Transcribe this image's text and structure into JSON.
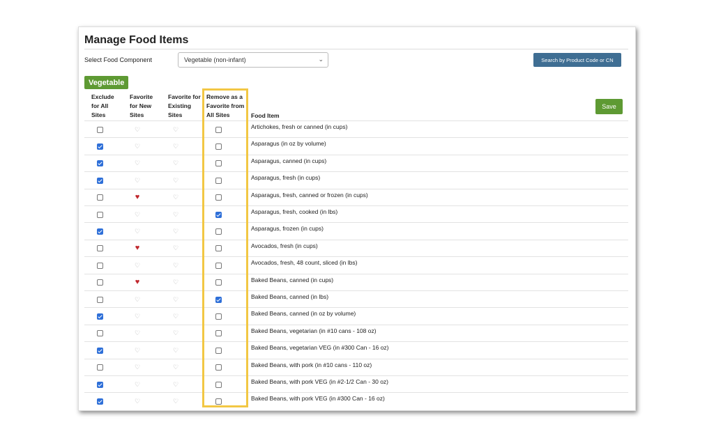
{
  "page": {
    "title": "Manage Food Items",
    "select_label": "Select Food Component",
    "selected_component": "Vegetable (non-infant)",
    "search_button": "Search by Product Code or CN",
    "category": "Vegetable",
    "save_button": "Save"
  },
  "columns": {
    "exclude": "Exclude for All Sites",
    "fav_new": "Favorite for New Sites",
    "fav_existing": "Favorite for Existing Sites",
    "remove_fav": "Remove as a Favorite from All Sites",
    "food_item": "Food Item"
  },
  "colors": {
    "accent_green": "#5e9a33",
    "search_blue": "#3f6e93",
    "highlight": "#f2c744",
    "heart_red": "#c0272d"
  },
  "rows": [
    {
      "exclude": false,
      "fav_new": false,
      "remove": false,
      "item": "Artichokes, fresh or canned (in cups)"
    },
    {
      "exclude": true,
      "fav_new": false,
      "remove": false,
      "item": "Asparagus (in oz by volume)"
    },
    {
      "exclude": true,
      "fav_new": false,
      "remove": false,
      "item": "Asparagus, canned (in cups)"
    },
    {
      "exclude": true,
      "fav_new": false,
      "remove": false,
      "item": "Asparagus, fresh (in cups)"
    },
    {
      "exclude": false,
      "fav_new": true,
      "remove": false,
      "item": "Asparagus, fresh, canned or frozen (in cups)"
    },
    {
      "exclude": false,
      "fav_new": false,
      "remove": true,
      "item": "Asparagus, fresh, cooked (in lbs)"
    },
    {
      "exclude": true,
      "fav_new": false,
      "remove": false,
      "item": "Asparagus, frozen (in cups)"
    },
    {
      "exclude": false,
      "fav_new": true,
      "remove": false,
      "item": "Avocados, fresh (in cups)"
    },
    {
      "exclude": false,
      "fav_new": false,
      "remove": false,
      "item": "Avocados, fresh, 48 count, sliced (in lbs)"
    },
    {
      "exclude": false,
      "fav_new": true,
      "remove": false,
      "item": "Baked Beans, canned (in cups)"
    },
    {
      "exclude": false,
      "fav_new": false,
      "remove": true,
      "item": "Baked Beans, canned (in lbs)"
    },
    {
      "exclude": true,
      "fav_new": false,
      "remove": false,
      "item": "Baked Beans, canned (in oz by volume)"
    },
    {
      "exclude": false,
      "fav_new": false,
      "remove": false,
      "item": "Baked Beans, vegetarian (in #10 cans - 108 oz)"
    },
    {
      "exclude": true,
      "fav_new": false,
      "remove": false,
      "item": "Baked Beans, vegetarian VEG (in #300 Can - 16 oz)"
    },
    {
      "exclude": false,
      "fav_new": false,
      "remove": false,
      "item": "Baked Beans, with pork (in #10 cans - 110 oz)"
    },
    {
      "exclude": true,
      "fav_new": false,
      "remove": false,
      "item": "Baked Beans, with pork VEG (in #2-1/2 Can - 30 oz)"
    },
    {
      "exclude": true,
      "fav_new": false,
      "remove": false,
      "item": "Baked Beans, with pork VEG (in #300 Can - 16 oz)"
    }
  ]
}
